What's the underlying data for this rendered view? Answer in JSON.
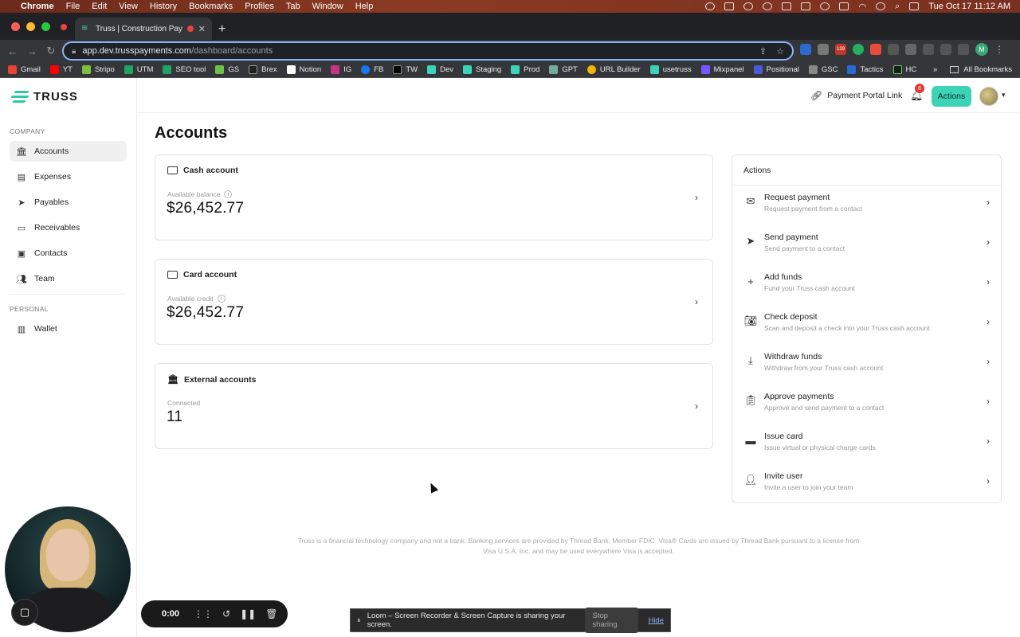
{
  "menubar": {
    "app": "Chrome",
    "items": [
      "File",
      "Edit",
      "View",
      "History",
      "Bookmarks",
      "Profiles",
      "Tab",
      "Window",
      "Help"
    ],
    "clock": "Tue Oct 17  11:12 AM"
  },
  "browser": {
    "tab_title": "Truss | Construction Paym",
    "url_host": "app.dev.trusspayments.com",
    "url_path": "/dashboard/accounts",
    "bookmarks": [
      "Gmail",
      "YT",
      "Stripo",
      "UTM",
      "SEO tool",
      "GS",
      "Brex",
      "Notion",
      "IG",
      "FB",
      "TW",
      "Dev",
      "Staging",
      "Prod",
      "GPT",
      "URL Builder",
      "usetruss",
      "Mixpanel",
      "Positional",
      "GSC",
      "Tactics",
      "HC"
    ],
    "all_bookmarks": "All Bookmarks",
    "profile_initial": "M",
    "ext_badge_1": "139"
  },
  "brand": {
    "name": "TRUSS",
    "accent": "#3cd3b7"
  },
  "sidebar": {
    "company_label": "COMPANY",
    "personal_label": "PERSONAL",
    "items": [
      {
        "label": "Accounts",
        "icon": "bank-icon"
      },
      {
        "label": "Expenses",
        "icon": "receipt-icon"
      },
      {
        "label": "Payables",
        "icon": "send-icon"
      },
      {
        "label": "Receivables",
        "icon": "inbox-icon"
      },
      {
        "label": "Contacts",
        "icon": "contacts-icon"
      },
      {
        "label": "Team",
        "icon": "team-icon"
      }
    ],
    "personal_items": [
      {
        "label": "Wallet",
        "icon": "wallet-icon"
      }
    ]
  },
  "topbar": {
    "payment_portal_link": "Payment Portal Link",
    "notifications_count": "8",
    "actions_label": "Actions"
  },
  "page": {
    "title": "Accounts",
    "cards": [
      {
        "title": "Cash account",
        "label": "Available balance",
        "value": "$26,452.77"
      },
      {
        "title": "Card account",
        "label": "Available credit",
        "value": "$26,452.77"
      },
      {
        "title": "External accounts",
        "label": "Connected",
        "value": "11"
      }
    ]
  },
  "actions_panel": {
    "title": "Actions",
    "items": [
      {
        "title": "Request payment",
        "subtitle": "Request payment from a contact"
      },
      {
        "title": "Send payment",
        "subtitle": "Send payment to a contact"
      },
      {
        "title": "Add funds",
        "subtitle": "Fund your Truss cash account"
      },
      {
        "title": "Check deposit",
        "subtitle": "Scan and deposit a check into your Truss cash account"
      },
      {
        "title": "Withdraw funds",
        "subtitle": "Withdraw from your Truss cash account"
      },
      {
        "title": "Approve payments",
        "subtitle": "Approve and send payment to a contact"
      },
      {
        "title": "Issue card",
        "subtitle": "Issue virtual or physical charge cards"
      },
      {
        "title": "Invite user",
        "subtitle": "Invite a user to join your team"
      }
    ]
  },
  "footer": {
    "disclaimer": "Truss is a financial technology company and not a bank. Banking services are provided by Thread Bank, Member FDIC. Visa® Cards are issued by Thread Bank pursuant to a license from Visa U.S.A. Inc. and may be used everywhere Visa is accepted."
  },
  "loom": {
    "timer": "0:00",
    "share_message": "Loom – Screen Recorder & Screen Capture is sharing your screen.",
    "stop_label": "Stop sharing",
    "hide_label": "Hide"
  }
}
